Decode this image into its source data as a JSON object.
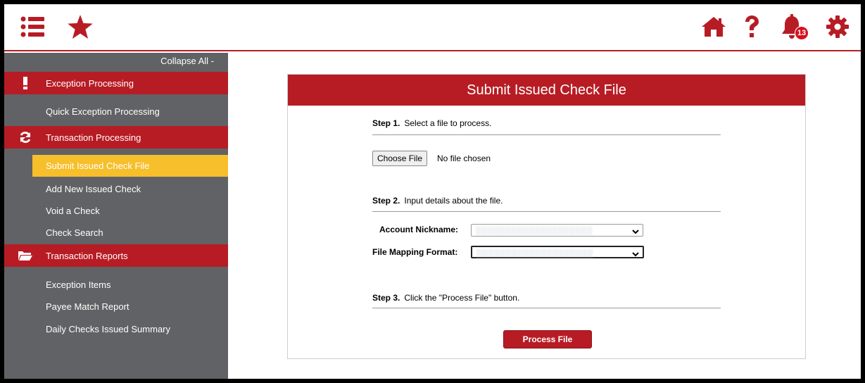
{
  "topbar": {
    "menu_icon": "menu-list-icon",
    "favorites_icon": "star-icon",
    "home_icon": "home-icon",
    "help_icon": "question-icon",
    "notifications_icon": "bell-icon",
    "notifications_count": "13",
    "settings_icon": "gear-icon"
  },
  "sidebar": {
    "collapse_label": "Collapse All -",
    "sections": [
      {
        "label": "Exception Processing",
        "icon": "exclamation-icon"
      },
      {
        "label": "Transaction Processing",
        "icon": "refresh-icon"
      },
      {
        "label": "Transaction Reports",
        "icon": "folder-open-icon"
      }
    ],
    "items": [
      {
        "label": "Quick Exception Processing"
      },
      {
        "label": "Submit Issued Check File",
        "active": true
      },
      {
        "label": "Add New Issued Check"
      },
      {
        "label": "Void a Check"
      },
      {
        "label": "Check Search"
      },
      {
        "label": "Exception Items"
      },
      {
        "label": "Payee Match Report"
      },
      {
        "label": "Daily Checks Issued Summary"
      }
    ]
  },
  "form": {
    "title": "Submit Issued Check File",
    "step1": {
      "num": "Step 1.",
      "text": "Select a file to process."
    },
    "choose_file_label": "Choose File",
    "no_file_text": "No file chosen",
    "step2": {
      "num": "Step 2.",
      "text": "Input details about the file."
    },
    "account_label": "Account Nickname:",
    "mapping_label": "File Mapping Format:",
    "step3": {
      "num": "Step 3.",
      "text": "Click the \"Process File\" button."
    },
    "process_label": "Process File"
  },
  "colors": {
    "brand_red": "#b71c24",
    "sidebar_gray": "#616265",
    "active_yellow": "#f6bf2b",
    "badge_red": "#d6101e"
  }
}
